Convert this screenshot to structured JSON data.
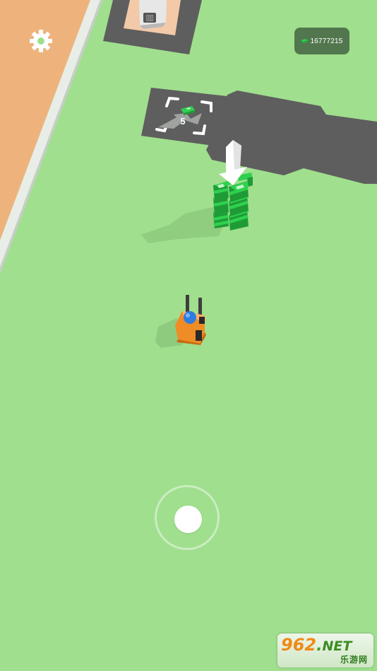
{
  "hud": {
    "settings_icon": "gear-icon",
    "money": {
      "icon": "cash-stack-icon",
      "value": "16777215"
    }
  },
  "world": {
    "ground_color": "#a0df8e",
    "sidewalk_color": "#eeb37c",
    "road_color": "#5e5e5e",
    "pad_color": "#5e5e5e",
    "cash_color": "#2fd14f",
    "forklift_color": "#f08c25",
    "driver_color": "#2f7ce0",
    "upgrade_pad": {
      "icon": "cash-icon",
      "count": "5"
    }
  },
  "joystick": {
    "ring_icon": "joystick-ring",
    "knob_icon": "joystick-knob"
  },
  "watermark": {
    "line1": "962",
    "dot": ".",
    "line1_suffix": "NET",
    "line2": "乐游网"
  }
}
